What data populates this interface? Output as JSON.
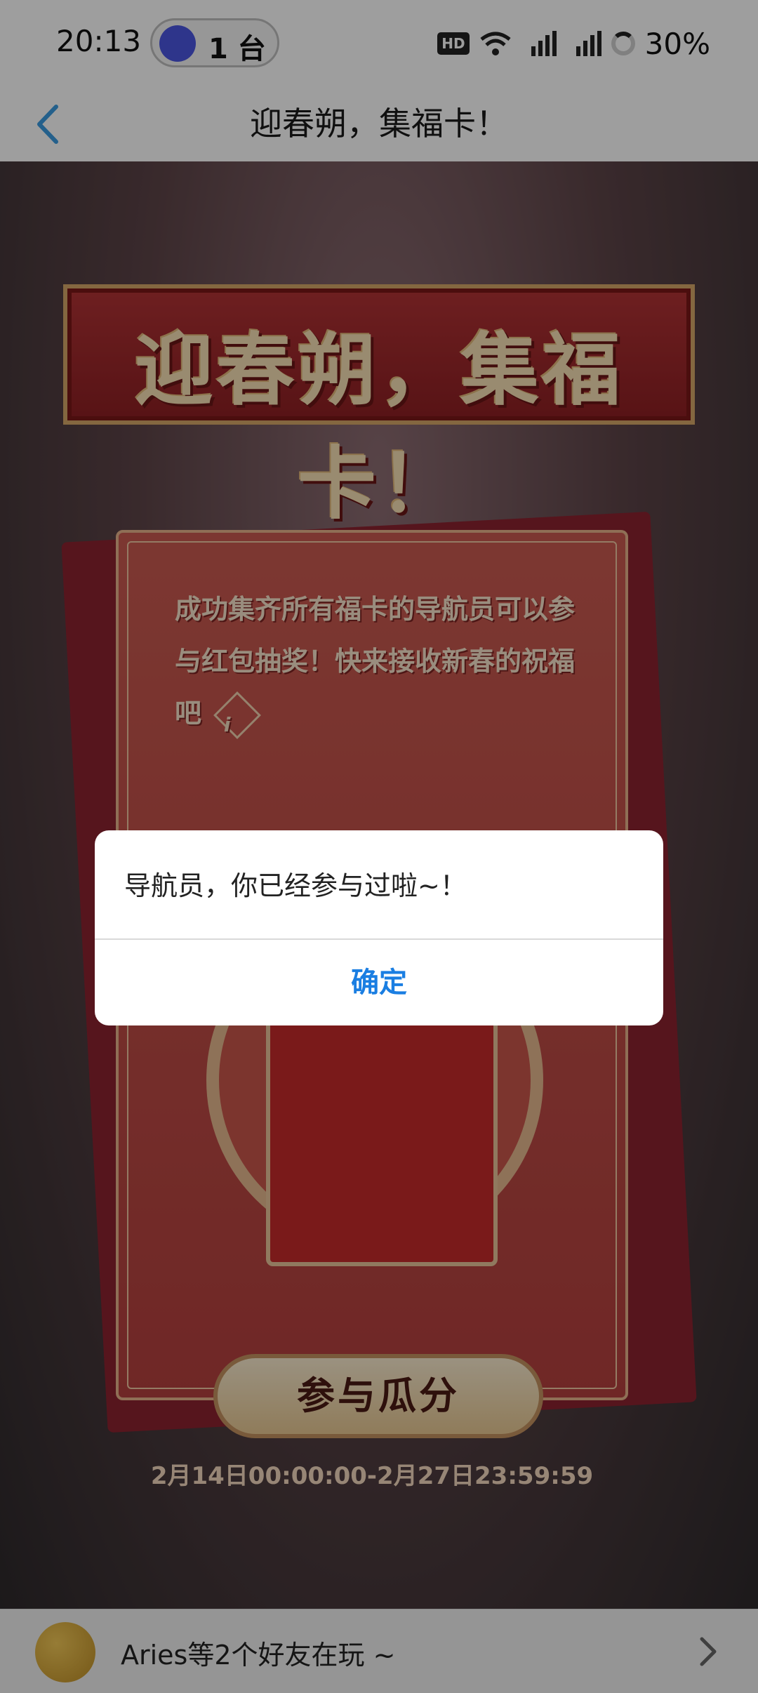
{
  "status_bar": {
    "time": "20:13",
    "pill_text": "1 台",
    "hd": "HD",
    "battery": "30%"
  },
  "nav": {
    "title": "迎春朔，集福卡！",
    "back_icon": "chevron-left-icon"
  },
  "banner": {
    "title": "迎春朔，集福卡！"
  },
  "card": {
    "description": "成功集齐所有福卡的导航员可以参与红包抽奖！快来接收新春的祝福吧",
    "info_glyph": "i",
    "join_button": "参与瓜分",
    "date_range": "2月14日00:00:00-2月27日23:59:59"
  },
  "dialog": {
    "message": "导航员，你已经参与过啦~！",
    "confirm": "确定"
  },
  "bottom_bar": {
    "friends_text": "Aries等2个好友在玩 ~"
  },
  "colors": {
    "accent": "#1a7ee2",
    "back_icon": "#3a9be0",
    "banner_red": "#b23335",
    "card_red": "#c95a50"
  }
}
